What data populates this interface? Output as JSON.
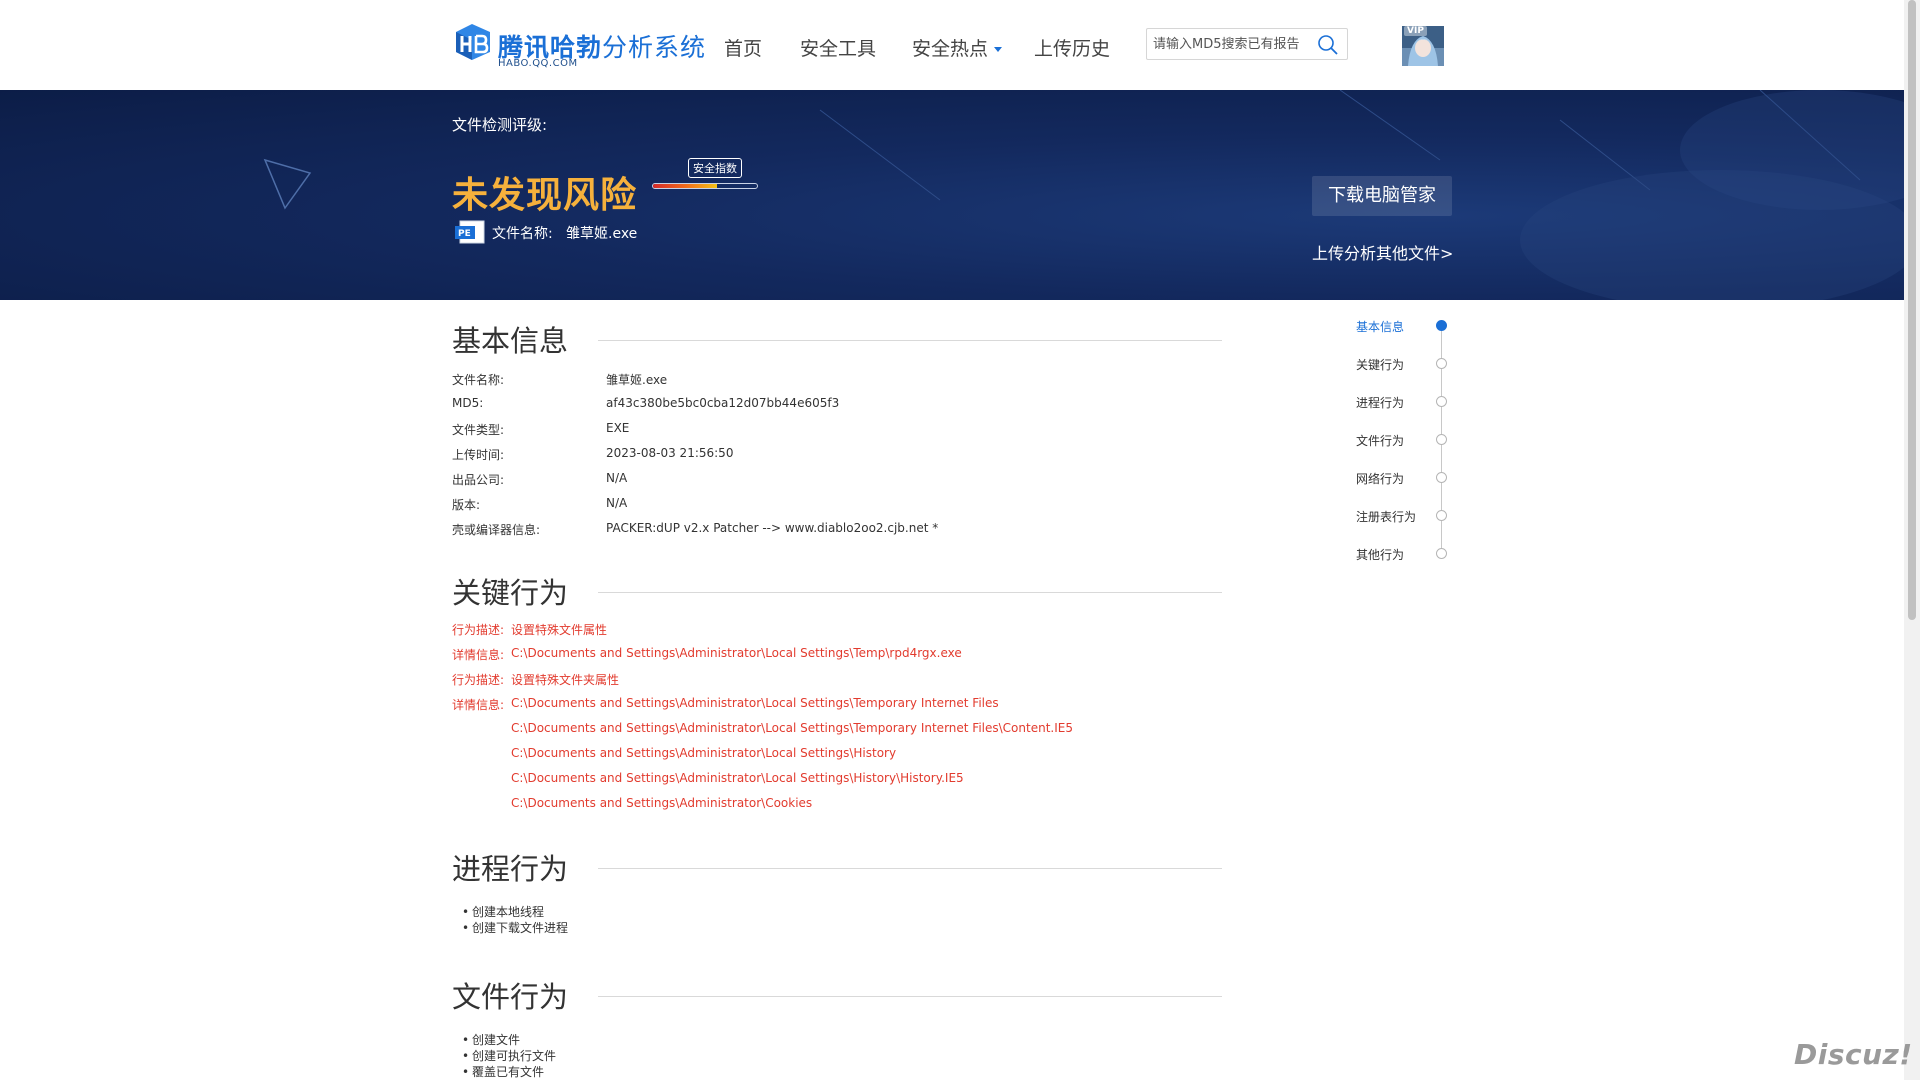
{
  "header": {
    "logo_bold": "腾讯哈勃",
    "logo_light": "分析系统",
    "logo_sub": "HABO.QQ.COM",
    "nav": [
      {
        "label": "首页"
      },
      {
        "label": "安全工具"
      },
      {
        "label": "安全热点"
      },
      {
        "label": "上传历史"
      }
    ],
    "search_placeholder": "请输入MD5搜索已有报告",
    "avatar_badge": "VIP"
  },
  "banner": {
    "rating_label": "文件检测评级:",
    "verdict": "未发现风险",
    "score_tag": "安全指数",
    "score_fraction": 0.62,
    "file_type_badge": "PE",
    "file_label": "文件名称:",
    "file_name": "雏草姬.exe",
    "download_button": "下载电脑管家",
    "upload_link": "上传分析其他文件>"
  },
  "basic_info": {
    "title": "基本信息",
    "rows": [
      {
        "key": "文件名称:",
        "value": "雏草姬.exe"
      },
      {
        "key": "MD5:",
        "value": "af43c380be5bc0cba12d07bb44e605f3"
      },
      {
        "key": "文件类型:",
        "value": "EXE"
      },
      {
        "key": "上传时间:",
        "value": "2023-08-03 21:56:50"
      },
      {
        "key": "出品公司:",
        "value": "N/A"
      },
      {
        "key": "版本:",
        "value": "N/A"
      },
      {
        "key": "壳或编译器信息:",
        "value": "PACKER:dUP v2.x Patcher --> www.diablo2oo2.cjb.net *"
      }
    ]
  },
  "key_behavior": {
    "title": "关键行为",
    "rows": [
      {
        "key": "行为描述:",
        "value": "设置特殊文件属性"
      },
      {
        "key": "详情信息:",
        "value": "C:\\Documents and Settings\\Administrator\\Local Settings\\Temp\\rpd4rgx.exe"
      },
      {
        "key": "行为描述:",
        "value": "设置特殊文件夹属性"
      },
      {
        "key": "详情信息:",
        "value": "C:\\Documents and Settings\\Administrator\\Local Settings\\Temporary Internet Files"
      },
      {
        "key": "",
        "value": "C:\\Documents and Settings\\Administrator\\Local Settings\\Temporary Internet Files\\Content.IE5"
      },
      {
        "key": "",
        "value": "C:\\Documents and Settings\\Administrator\\Local Settings\\History"
      },
      {
        "key": "",
        "value": "C:\\Documents and Settings\\Administrator\\Local Settings\\History\\History.IE5"
      },
      {
        "key": "",
        "value": "C:\\Documents and Settings\\Administrator\\Cookies"
      }
    ]
  },
  "process_behavior": {
    "title": "进程行为",
    "items": [
      "创建本地线程",
      "创建下载文件进程"
    ]
  },
  "file_behavior": {
    "title": "文件行为",
    "items": [
      "创建文件",
      "创建可执行文件",
      "覆盖已有文件"
    ]
  },
  "side_nav": {
    "items": [
      {
        "label": "基本信息",
        "active": true
      },
      {
        "label": "关键行为",
        "active": false
      },
      {
        "label": "进程行为",
        "active": false
      },
      {
        "label": "文件行为",
        "active": false
      },
      {
        "label": "网络行为",
        "active": false
      },
      {
        "label": "注册表行为",
        "active": false
      },
      {
        "label": "其他行为",
        "active": false
      }
    ]
  },
  "watermark": "Discuz!",
  "colors": {
    "accent": "#1a6fd6",
    "verdict": "#f6b13c",
    "alert": "#e23b2e",
    "banner": "#13295e"
  }
}
